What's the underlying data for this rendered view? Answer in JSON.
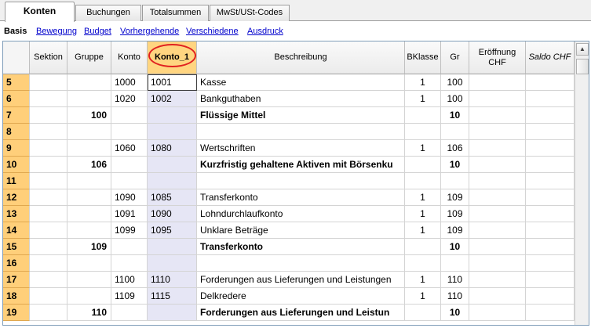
{
  "tabs": [
    {
      "label": "Konten"
    },
    {
      "label": "Buchungen"
    },
    {
      "label": "Totalsummen"
    },
    {
      "label": "MwSt/USt-Codes"
    }
  ],
  "subtabs": [
    {
      "label": "Basis"
    },
    {
      "label": "Bewegung"
    },
    {
      "label": "Budget"
    },
    {
      "label": "Vorhergehende"
    },
    {
      "label": "Verschiedene"
    },
    {
      "label": "Ausdruck"
    }
  ],
  "columns": {
    "sektion": "Sektion",
    "gruppe": "Gruppe",
    "konto": "Konto",
    "konto1": "Konto_1",
    "beschreibung": "Beschreibung",
    "bklasse": "BKlasse",
    "gr": "Gr",
    "eroeffnung_line1": "Eröffnung",
    "eroeffnung_line2": "CHF",
    "saldo": "Saldo CHF"
  },
  "scrollbar": {
    "up_icon": "up-arrow-icon"
  },
  "rows": [
    {
      "num": "5",
      "sektion": "",
      "gruppe": "",
      "konto": "1000",
      "konto1": "1001",
      "beschreibung": "Kasse",
      "bklasse": "1",
      "gr": "100",
      "bold": false
    },
    {
      "num": "6",
      "sektion": "",
      "gruppe": "",
      "konto": "1020",
      "konto1": "1002",
      "beschreibung": "Bankguthaben",
      "bklasse": "1",
      "gr": "100",
      "bold": false
    },
    {
      "num": "7",
      "sektion": "",
      "gruppe": "100",
      "konto": "",
      "konto1": "",
      "beschreibung": "Flüssige Mittel",
      "bklasse": "",
      "gr": "10",
      "bold": true
    },
    {
      "num": "8",
      "sektion": "",
      "gruppe": "",
      "konto": "",
      "konto1": "",
      "beschreibung": "",
      "bklasse": "",
      "gr": "",
      "bold": false
    },
    {
      "num": "9",
      "sektion": "",
      "gruppe": "",
      "konto": "1060",
      "konto1": "1080",
      "beschreibung": "Wertschriften",
      "bklasse": "1",
      "gr": "106",
      "bold": false
    },
    {
      "num": "10",
      "sektion": "",
      "gruppe": "106",
      "konto": "",
      "konto1": "",
      "beschreibung": "Kurzfristig gehaltene Aktiven mit Börsenku",
      "bklasse": "",
      "gr": "10",
      "bold": true
    },
    {
      "num": "11",
      "sektion": "",
      "gruppe": "",
      "konto": "",
      "konto1": "",
      "beschreibung": "",
      "bklasse": "",
      "gr": "",
      "bold": false
    },
    {
      "num": "12",
      "sektion": "",
      "gruppe": "",
      "konto": "1090",
      "konto1": "1085",
      "beschreibung": "Transferkonto",
      "bklasse": "1",
      "gr": "109",
      "bold": false
    },
    {
      "num": "13",
      "sektion": "",
      "gruppe": "",
      "konto": "1091",
      "konto1": "1090",
      "beschreibung": "Lohndurchlaufkonto",
      "bklasse": "1",
      "gr": "109",
      "bold": false
    },
    {
      "num": "14",
      "sektion": "",
      "gruppe": "",
      "konto": "1099",
      "konto1": "1095",
      "beschreibung": "Unklare Beträge",
      "bklasse": "1",
      "gr": "109",
      "bold": false
    },
    {
      "num": "15",
      "sektion": "",
      "gruppe": "109",
      "konto": "",
      "konto1": "",
      "beschreibung": "Transferkonto",
      "bklasse": "",
      "gr": "10",
      "bold": true
    },
    {
      "num": "16",
      "sektion": "",
      "gruppe": "",
      "konto": "",
      "konto1": "",
      "beschreibung": "",
      "bklasse": "",
      "gr": "",
      "bold": false
    },
    {
      "num": "17",
      "sektion": "",
      "gruppe": "",
      "konto": "1100",
      "konto1": "1110",
      "beschreibung": "Forderungen aus Lieferungen und Leistungen",
      "bklasse": "1",
      "gr": "110",
      "bold": false
    },
    {
      "num": "18",
      "sektion": "",
      "gruppe": "",
      "konto": "1109",
      "konto1": "1115",
      "beschreibung": "Delkredere",
      "bklasse": "1",
      "gr": "110",
      "bold": false
    },
    {
      "num": "19",
      "sektion": "",
      "gruppe": "110",
      "konto": "",
      "konto1": "",
      "beschreibung": "Forderungen aus Lieferungen und Leistun",
      "bklasse": "",
      "gr": "10",
      "bold": true
    }
  ]
}
